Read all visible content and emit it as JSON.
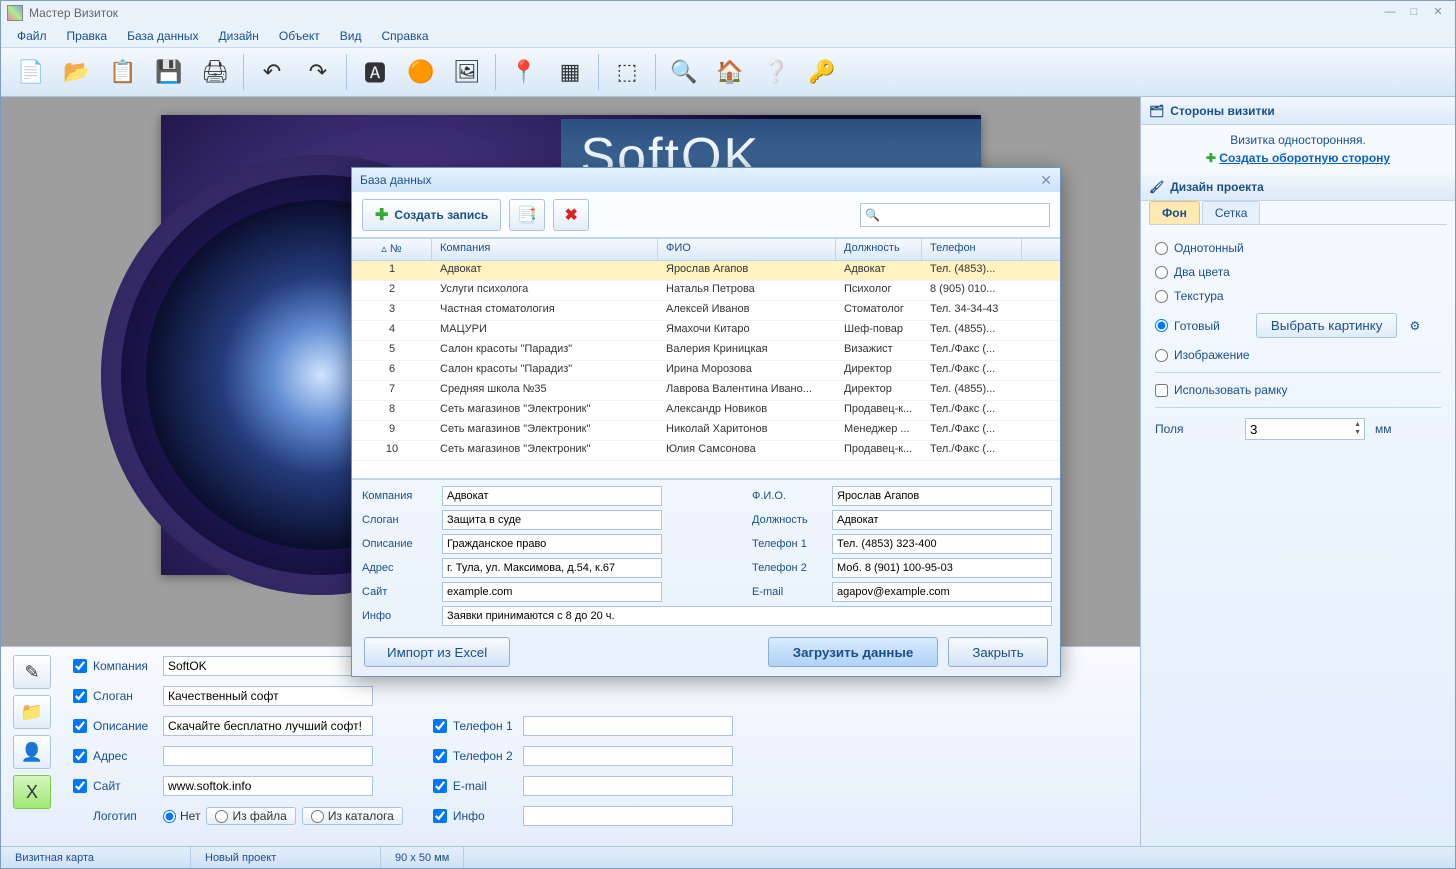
{
  "app": {
    "title": "Мастер Визиток"
  },
  "menu": [
    "Файл",
    "Правка",
    "База данных",
    "Дизайн",
    "Объект",
    "Вид",
    "Справка"
  ],
  "toolbar_icons": [
    "new-icon",
    "open-icon",
    "paste-icon",
    "save-icon",
    "print-icon",
    "sep",
    "undo-icon",
    "redo-icon",
    "sep",
    "text-icon",
    "shape-icon",
    "image-icon",
    "sep",
    "map-icon",
    "qr-icon",
    "sep",
    "crop-icon",
    "sep",
    "preview-icon",
    "home-icon",
    "help-icon",
    "keys-icon"
  ],
  "toolbar_glyphs": {
    "new-icon": "📄",
    "open-icon": "📂",
    "paste-icon": "📋",
    "save-icon": "💾",
    "print-icon": "🖨",
    "undo-icon": "↶",
    "redo-icon": "↷",
    "text-icon": "🅰",
    "shape-icon": "🟠",
    "image-icon": "🖼",
    "map-icon": "📍",
    "qr-icon": "▦",
    "crop-icon": "⬚",
    "preview-icon": "🔍",
    "home-icon": "🏠",
    "help-icon": "❔",
    "keys-icon": "🔑"
  },
  "card": {
    "banner": "SoftOK"
  },
  "props": {
    "company_lbl": "Компания",
    "company_val": "SoftOK",
    "slogan_lbl": "Слоган",
    "slogan_val": "Качественный софт",
    "desc_lbl": "Описание",
    "desc_val": "Скачайте бесплатно лучший софт!",
    "addr_lbl": "Адрес",
    "addr_val": "",
    "site_lbl": "Сайт",
    "site_val": "www.softok.info",
    "logo_lbl": "Логотип",
    "logo_none": "Нет",
    "logo_file": "Из файла",
    "logo_catalog": "Из каталога",
    "tel1_lbl": "Телефон 1",
    "tel1_val": "",
    "tel2_lbl": "Телефон 2",
    "tel2_val": "",
    "email_lbl": "E-mail",
    "email_val": "",
    "info_lbl": "Инфо",
    "info_val": ""
  },
  "status": {
    "left": "Визитная карта",
    "mid": "Новый проект",
    "right": "90 x 50 мм"
  },
  "rp": {
    "sides_title": "Стороны визитки",
    "sides_text": "Визитка односторонняя.",
    "sides_link": "Создать оборотную сторону",
    "design_title": "Дизайн проекта",
    "tab_bg": "Фон",
    "tab_grid": "Сетка",
    "r_solid": "Однотонный",
    "r_two": "Два цвета",
    "r_texture": "Текстура",
    "r_ready": "Готовый",
    "r_image": "Изображение",
    "ready_btn": "Выбрать картинку",
    "frame_chk": "Использовать рамку",
    "margins_lbl": "Поля",
    "margins_val": "3",
    "margins_unit": "мм"
  },
  "dialog": {
    "title": "База данных",
    "create_btn": "Создать запись",
    "cols": {
      "num": "№",
      "company": "Компания",
      "fio": "ФИО",
      "position": "Должность",
      "tel": "Телефон"
    },
    "rows": [
      {
        "n": "1",
        "c": "Адвокат",
        "f": "Ярослав Агапов",
        "p": "Адвокат",
        "t": "Тел. (4853)..."
      },
      {
        "n": "2",
        "c": "Услуги психолога",
        "f": "Наталья Петрова",
        "p": "Психолог",
        "t": "8 (905) 010..."
      },
      {
        "n": "3",
        "c": "Частная стоматология",
        "f": "Алексей Иванов",
        "p": "Стоматолог",
        "t": "Тел. 34-34-43"
      },
      {
        "n": "4",
        "c": "МАЦУРИ",
        "f": "Ямахочи Китаро",
        "p": "Шеф-повар",
        "t": "Тел. (4855)..."
      },
      {
        "n": "5",
        "c": "Салон красоты \"Парадиз\"",
        "f": "Валерия Криницкая",
        "p": "Визажист",
        "t": "Тел./Факс (..."
      },
      {
        "n": "6",
        "c": "Салон красоты \"Парадиз\"",
        "f": "Ирина Морозова",
        "p": "Директор",
        "t": "Тел./Факс (..."
      },
      {
        "n": "7",
        "c": "Средняя школа №35",
        "f": "Лаврова Валентина Ивано...",
        "p": "Директор",
        "t": "Тел. (4855)..."
      },
      {
        "n": "8",
        "c": "Сеть магазинов \"Электроник\"",
        "f": "Александр Новиков",
        "p": "Продавец-к...",
        "t": "Тел./Факс (..."
      },
      {
        "n": "9",
        "c": "Сеть магазинов \"Электроник\"",
        "f": "Николай Харитонов",
        "p": "Менеджер ...",
        "t": "Тел./Факс (..."
      },
      {
        "n": "10",
        "c": "Сеть магазинов \"Электроник\"",
        "f": "Юлия Самсонова",
        "p": "Продавец-к...",
        "t": "Тел./Факс (..."
      }
    ],
    "form": {
      "company_lbl": "Компания",
      "company_val": "Адвокат",
      "slogan_lbl": "Слоган",
      "slogan_val": "Защита в суде",
      "desc_lbl": "Описание",
      "desc_val": "Гражданское право",
      "addr_lbl": "Адрес",
      "addr_val": "г. Тула, ул. Максимова, д.54, к.67",
      "site_lbl": "Сайт",
      "site_val": "example.com",
      "info_lbl": "Инфо",
      "info_val": "Заявки принимаются с 8 до 20 ч.",
      "fio_lbl": "Ф.И.О.",
      "fio_val": "Ярослав Агапов",
      "pos_lbl": "Должность",
      "pos_val": "Адвокат",
      "tel1_lbl": "Телефон 1",
      "tel1_val": "Тел. (4853) 323-400",
      "tel2_lbl": "Телефон 2",
      "tel2_val": "Моб. 8 (901) 100-95-03",
      "email_lbl": "E-mail",
      "email_val": "agapov@example.com"
    },
    "import_btn": "Импорт из Excel",
    "load_btn": "Загрузить данные",
    "close_btn": "Закрыть"
  }
}
